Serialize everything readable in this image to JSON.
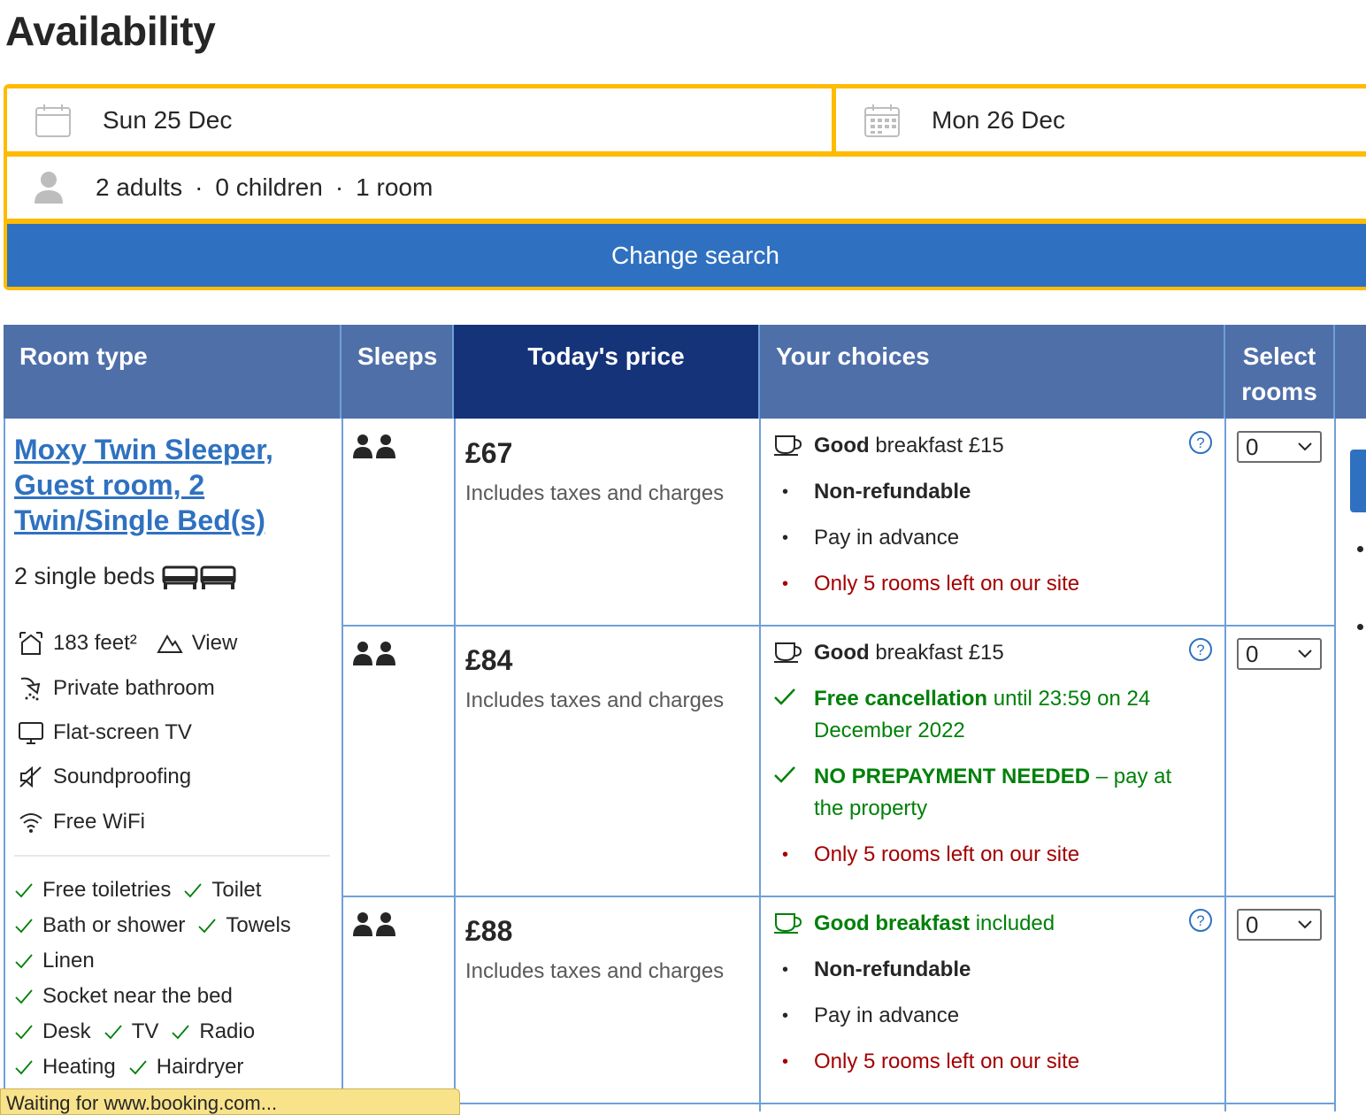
{
  "page": {
    "heading": "Availability"
  },
  "search": {
    "checkin": "Sun 25 Dec",
    "checkout": "Mon 26 Dec",
    "adults": "2 adults",
    "children": "0 children",
    "rooms": "1 room",
    "separator": "·",
    "button_label": "Change search",
    "border_color": "#febb02",
    "button_color": "#2f71c0"
  },
  "table": {
    "headers": {
      "room_type": "Room type",
      "sleeps": "Sleeps",
      "price": "Today's price",
      "choices": "Your choices",
      "select": "Select rooms"
    },
    "room": {
      "name": "Moxy Twin Sleeper, Guest room, 2 Twin/Single Bed(s)",
      "beds": "2 single beds",
      "size": "183 feet²",
      "view": "View",
      "facilities": [
        "Private bathroom",
        "Flat-screen TV",
        "Soundproofing",
        "Free WiFi"
      ],
      "amenities": [
        "Free toiletries",
        "Toilet",
        "Bath or shower",
        "Towels",
        "Linen",
        "Socket near the bed",
        "Desk",
        "TV",
        "Radio",
        "Heating",
        "Hairdryer"
      ]
    },
    "options": [
      {
        "price": "£67",
        "price_note": "Includes taxes and charges",
        "breakfast_bold": "Good",
        "breakfast_rest": " breakfast £15",
        "line1": "Non-refundable",
        "line2": "Pay in advance",
        "scarcity": "Only 5 rooms left on our site",
        "selected": "0"
      },
      {
        "price": "£84",
        "price_note": "Includes taxes and charges",
        "breakfast_bold": "Good",
        "breakfast_rest": " breakfast £15",
        "cancel_bold": "Free cancellation",
        "cancel_rest": " until 23:59 on 24 December 2022",
        "prepay_bold": "NO PREPAYMENT NEEDED",
        "prepay_rest": " – pay at the property",
        "scarcity": "Only 5 rooms left on our site",
        "selected": "0"
      },
      {
        "price": "£88",
        "price_note": "Includes taxes and charges",
        "breakfast_bold": "Good breakfast",
        "breakfast_rest": " included",
        "line1": "Non-refundable",
        "line2": "Pay in advance",
        "scarcity": "Only 5 rooms left on our site",
        "selected": "0"
      }
    ]
  },
  "statusbar": {
    "text": "Waiting for www.booking.com..."
  },
  "colors": {
    "header": "#4f6fa9",
    "header_dark": "#153379",
    "link": "#2f71c0",
    "green": "#008009",
    "red": "#a30000"
  }
}
